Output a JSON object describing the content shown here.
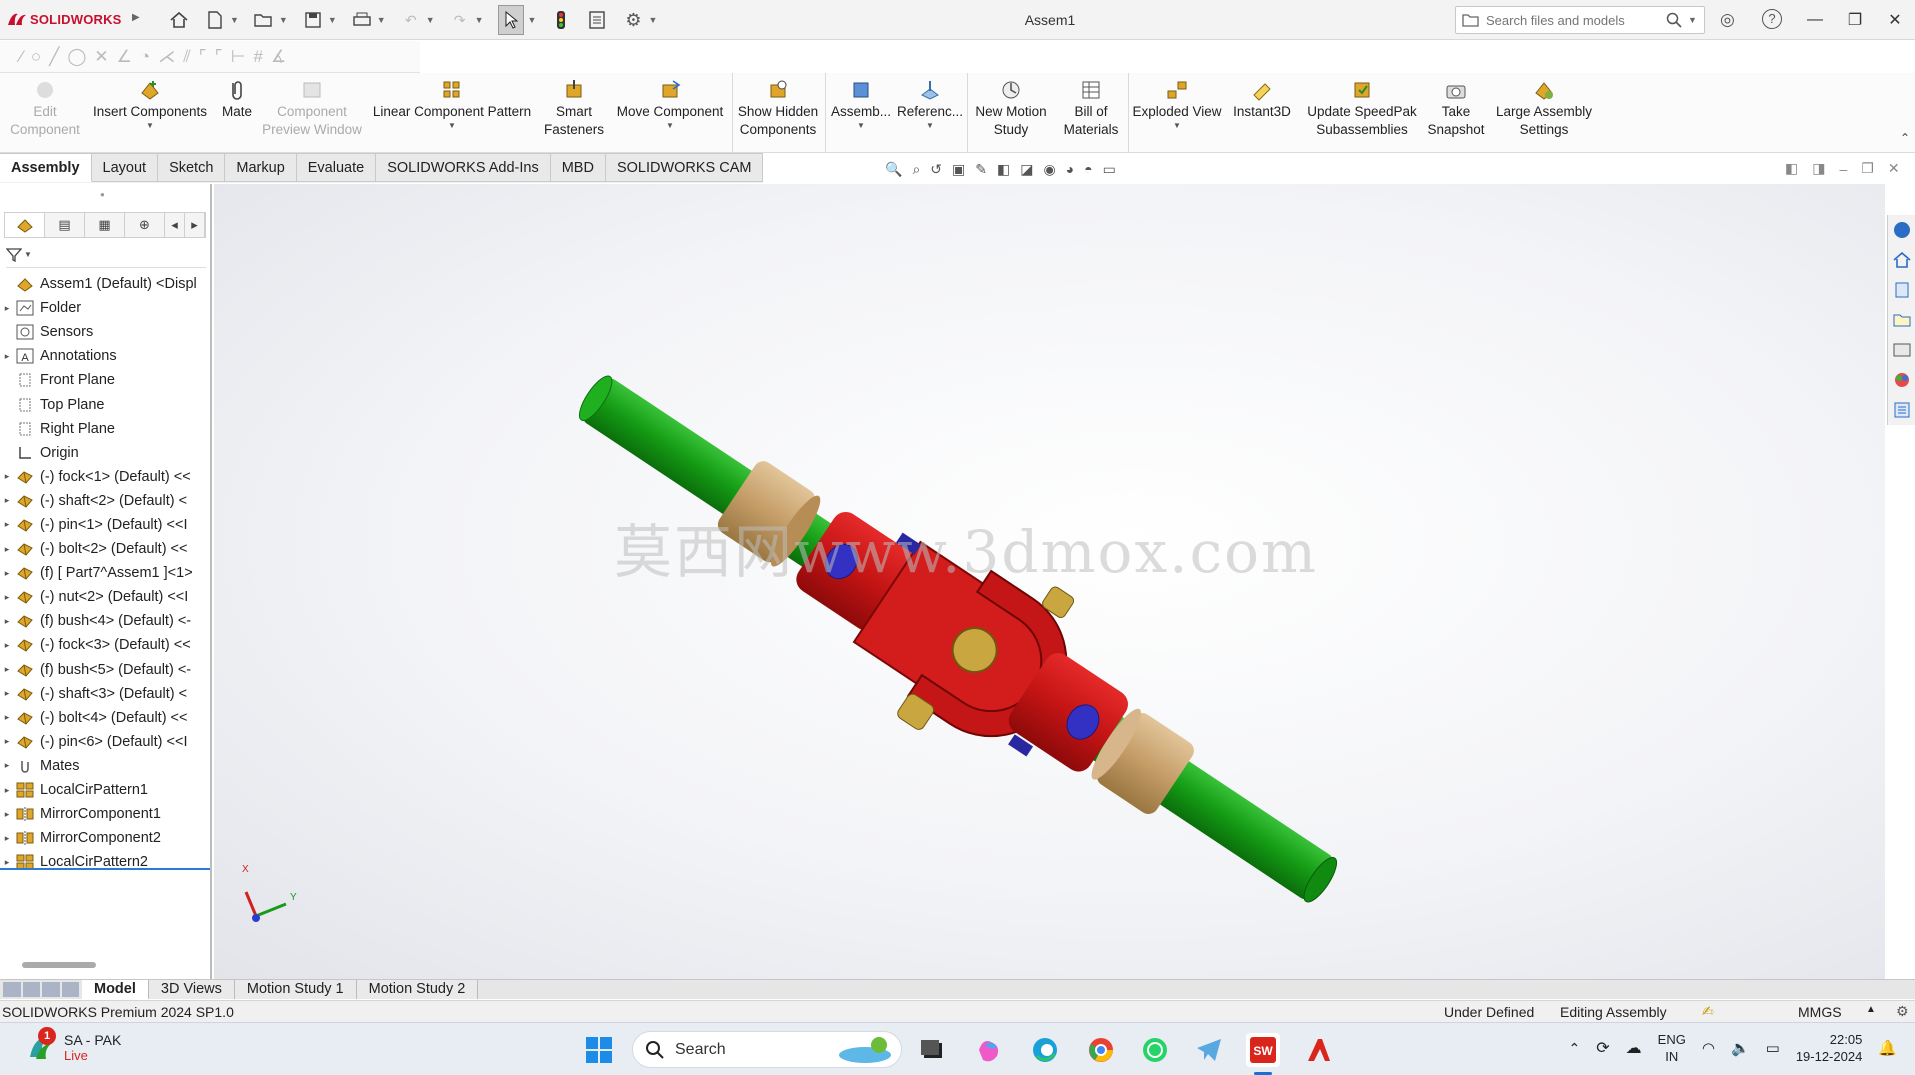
{
  "app": {
    "brand_bold": "SOLIDWORKS",
    "title": "Assem1"
  },
  "search": {
    "placeholder": "Search files and models"
  },
  "commands": [
    {
      "label": "Edit\nComponent",
      "disabled": true
    },
    {
      "label": "Insert Components",
      "disabled": false
    },
    {
      "label": "Mate",
      "disabled": false
    },
    {
      "label": "Component\nPreview Window",
      "disabled": true
    },
    {
      "label": "Linear Component Pattern",
      "disabled": false
    },
    {
      "label": "Smart\nFasteners",
      "disabled": false
    },
    {
      "label": "Move Component",
      "disabled": false
    },
    {
      "label": "Show Hidden\nComponents",
      "disabled": false
    },
    {
      "label": "Assemb...",
      "disabled": false
    },
    {
      "label": "Referenc...",
      "disabled": false
    },
    {
      "label": "New Motion\nStudy",
      "disabled": false
    },
    {
      "label": "Bill of\nMaterials",
      "disabled": false
    },
    {
      "label": "Exploded View",
      "disabled": false
    },
    {
      "label": "Instant3D",
      "disabled": false
    },
    {
      "label": "Update SpeedPak\nSubassemblies",
      "disabled": false
    },
    {
      "label": "Take\nSnapshot",
      "disabled": false
    },
    {
      "label": "Large Assembly\nSettings",
      "disabled": false
    }
  ],
  "tabs": [
    "Assembly",
    "Layout",
    "Sketch",
    "Markup",
    "Evaluate",
    "SOLIDWORKS Add-Ins",
    "MBD",
    "SOLIDWORKS CAM"
  ],
  "tree": [
    {
      "label": "Assem1 (Default) <Displ",
      "expander": "",
      "icon": "assembly-icon"
    },
    {
      "label": "Folder",
      "expander": "▸",
      "icon": "folder-icon"
    },
    {
      "label": "Sensors",
      "expander": "",
      "icon": "sensor-icon"
    },
    {
      "label": "Annotations",
      "expander": "▸",
      "icon": "annotation-icon"
    },
    {
      "label": "Front Plane",
      "expander": "",
      "icon": "plane-icon"
    },
    {
      "label": "Top Plane",
      "expander": "",
      "icon": "plane-icon"
    },
    {
      "label": "Right Plane",
      "expander": "",
      "icon": "plane-icon"
    },
    {
      "label": "Origin",
      "expander": "",
      "icon": "origin-icon"
    },
    {
      "label": "(-) fock<1> (Default) <<",
      "expander": "▸",
      "icon": "part-icon"
    },
    {
      "label": "(-) shaft<2> (Default) <",
      "expander": "▸",
      "icon": "part-icon"
    },
    {
      "label": "(-) pin<1> (Default) <<I",
      "expander": "▸",
      "icon": "part-icon"
    },
    {
      "label": "(-) bolt<2> (Default) <<",
      "expander": "▸",
      "icon": "part-icon"
    },
    {
      "label": "(f) [ Part7^Assem1 ]<1>",
      "expander": "▸",
      "icon": "part-icon"
    },
    {
      "label": "(-) nut<2> (Default) <<I",
      "expander": "▸",
      "icon": "part-icon"
    },
    {
      "label": "(f) bush<4> (Default) <-",
      "expander": "▸",
      "icon": "part-icon"
    },
    {
      "label": "(-) fock<3> (Default) <<",
      "expander": "▸",
      "icon": "part-icon"
    },
    {
      "label": "(f) bush<5> (Default) <-",
      "expander": "▸",
      "icon": "part-icon"
    },
    {
      "label": "(-) shaft<3> (Default) <",
      "expander": "▸",
      "icon": "part-icon"
    },
    {
      "label": "(-) bolt<4> (Default) <<",
      "expander": "▸",
      "icon": "part-icon"
    },
    {
      "label": "(-) pin<6> (Default) <<I",
      "expander": "▸",
      "icon": "part-icon"
    },
    {
      "label": "Mates",
      "expander": "▸",
      "icon": "mates-icon"
    },
    {
      "label": "LocalCirPattern1",
      "expander": "▸",
      "icon": "pattern-icon"
    },
    {
      "label": "MirrorComponent1",
      "expander": "▸",
      "icon": "mirror-icon"
    },
    {
      "label": "MirrorComponent2",
      "expander": "▸",
      "icon": "mirror-icon"
    },
    {
      "label": "LocalCirPattern2",
      "expander": "▸",
      "icon": "pattern-icon"
    }
  ],
  "viewport": {
    "watermark": "莫西网www.3dmox.com",
    "triad_x": "X",
    "triad_y": "Y"
  },
  "bottom_tabs": [
    "Model",
    "3D Views",
    "Motion Study 1",
    "Motion Study 2"
  ],
  "status": {
    "version": "SOLIDWORKS Premium 2024 SP1.0",
    "define_state": "Under Defined",
    "mode": "Editing Assembly",
    "units": "MMGS"
  },
  "taskbar": {
    "weather_title": "SA - PAK",
    "weather_sub": "Live",
    "notif_badge": "1",
    "search_label": "Search",
    "lang1": "ENG",
    "lang2": "IN",
    "time": "22:05",
    "date": "19-12-2024"
  },
  "colors": {
    "shaft": "#16a316",
    "yoke": "#c8141c",
    "bush": "#c9a574",
    "pin": "#2e2bb8",
    "accent": "#2a7ad6"
  }
}
